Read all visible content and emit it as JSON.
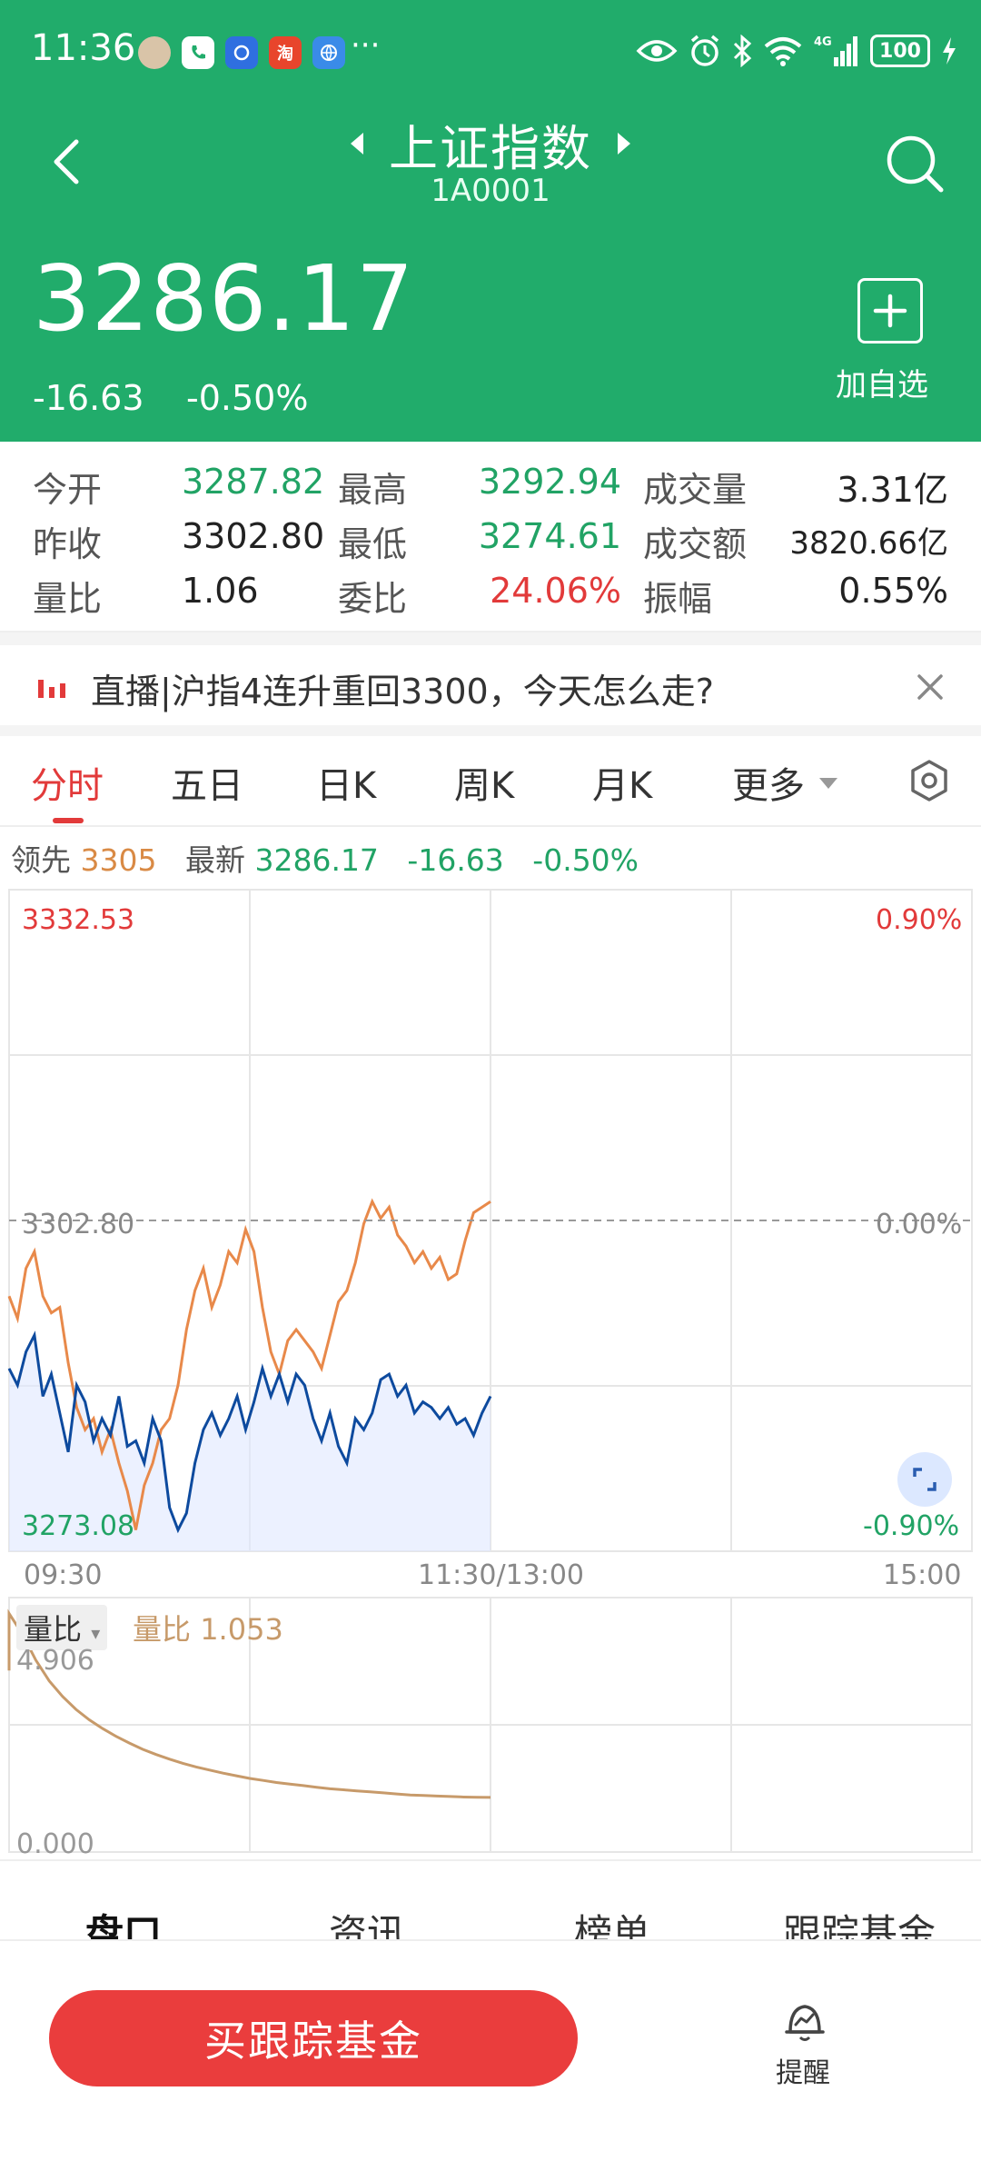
{
  "status_bar": {
    "time": "11:36",
    "app_icons": [
      "avatar-icon",
      "phone-icon",
      "blue-app-icon",
      "taobao-icon",
      "browser-icon"
    ],
    "taobao_char": "淘",
    "dots": "···",
    "network": "4G",
    "battery": "100"
  },
  "nav": {
    "title": "上证指数",
    "code": "1A0001"
  },
  "price": {
    "last": "3286.17",
    "change": "-16.63",
    "change_pct": "-0.50%",
    "add_label": "加自选"
  },
  "quote": {
    "rows": [
      [
        {
          "label": "今开",
          "value": "3287.82"
        },
        {
          "label": "最高",
          "value": "3292.94"
        },
        {
          "label": "成交量",
          "value": "3.31亿"
        }
      ],
      [
        {
          "label": "昨收",
          "value": "3302.80"
        },
        {
          "label": "最低",
          "value": "3274.61"
        },
        {
          "label": "成交额",
          "value": "3820.66亿"
        }
      ],
      [
        {
          "label": "量比",
          "value": "1.06"
        },
        {
          "label": "委比",
          "value": "24.06%"
        },
        {
          "label": "振幅",
          "value": "0.55%"
        }
      ]
    ]
  },
  "news": {
    "text": "直播|沪指4连升重回3300，今天怎么走?"
  },
  "tabs": [
    "分时",
    "五日",
    "日K",
    "周K",
    "月K",
    "更多"
  ],
  "info": {
    "lead_label": "领先",
    "lead_value": "3305",
    "latest_label": "最新",
    "latest_value": "3286.17",
    "change": "-16.63",
    "change_pct": "-0.50%"
  },
  "chart_axis": {
    "y_top": "3332.53",
    "y_mid": "3302.80",
    "y_bottom": "3273.08",
    "pct_top": "0.90%",
    "pct_mid": "0.00%",
    "pct_bottom": "-0.90%",
    "time_start": "09:30",
    "time_mid": "11:30/13:00",
    "time_end": "15:00"
  },
  "volume": {
    "tag": "量比",
    "info_label": "量比",
    "info_value": "1.053",
    "max": "4.906",
    "min": "0.000"
  },
  "bottom_tabs": [
    "盘口",
    "资讯",
    "榜单",
    "跟踪基金"
  ],
  "buy_label": "买跟踪基金",
  "remind_label": "提醒",
  "colors": {
    "header": "#21ac6b",
    "up": "#e23a3a",
    "down": "#21a365",
    "price_line": "#0d4a9e",
    "lead_line": "#e8894a",
    "ratio_line": "#c79a6a"
  },
  "chart_data": {
    "type": "line",
    "ylim": [
      3273.08,
      3332.53
    ],
    "baseline": 3302.8,
    "x_labels": [
      "09:30",
      "11:30/13:00",
      "15:00"
    ],
    "series": [
      {
        "name": "最新",
        "values": [
          3289.5,
          3288.0,
          3291.0,
          3292.5,
          3287.0,
          3289.0,
          3285.5,
          3282.0,
          3288.0,
          3286.5,
          3283.0,
          3285.0,
          3283.5,
          3287.0,
          3282.5,
          3283.0,
          3281.0,
          3285.0,
          3283.0,
          3277.0,
          3275.0,
          3276.5,
          3281.0,
          3284.0,
          3285.5,
          3283.5,
          3285.0,
          3287.0,
          3284.0,
          3286.5,
          3289.5,
          3287.0,
          3289.0,
          3286.5,
          3289.0,
          3288.0,
          3285.0,
          3283.0,
          3285.5,
          3282.5,
          3281.0,
          3285.0,
          3284.0,
          3285.5,
          3288.5,
          3289.0,
          3287.0,
          3288.0,
          3285.5,
          3286.5,
          3286.0,
          3285.0,
          3286.0,
          3284.5,
          3285.0,
          3283.5,
          3285.5,
          3287.0
        ],
        "note": ""
      },
      {
        "name": "领先",
        "values": [
          3296.0,
          3294.0,
          3298.5,
          3300.0,
          3296.0,
          3294.5,
          3295.0,
          3290.0,
          3286.0,
          3284.0,
          3285.0,
          3282.0,
          3284.0,
          3281.0,
          3278.5,
          3275.0,
          3279.0,
          3281.0,
          3284.0,
          3285.0,
          3288.0,
          3293.0,
          3296.5,
          3298.5,
          3295.0,
          3297.0,
          3300.0,
          3299.0,
          3302.0,
          3300.0,
          3295.0,
          3291.0,
          3289.0,
          3292.0,
          3293.0,
          3292.0,
          3291.0,
          3289.5,
          3292.5,
          3295.5,
          3296.5,
          3299.0,
          3302.5,
          3304.5,
          3303.0,
          3304.0,
          3301.5,
          3300.5,
          3299.0,
          3300.0,
          3298.5,
          3299.5,
          3297.5,
          3298.0,
          3301.0,
          3303.5,
          3304.0,
          3304.5
        ]
      }
    ],
    "volume_ratio": {
      "ylim": [
        0,
        4.906
      ],
      "values": [
        4.6,
        4.2,
        3.7,
        3.3,
        3.0,
        2.75,
        2.55,
        2.38,
        2.23,
        2.1,
        1.98,
        1.88,
        1.79,
        1.71,
        1.64,
        1.58,
        1.52,
        1.47,
        1.42,
        1.38,
        1.34,
        1.31,
        1.28,
        1.25,
        1.22,
        1.2,
        1.18,
        1.16,
        1.14,
        1.12,
        1.1,
        1.09,
        1.08,
        1.07,
        1.06,
        1.055,
        1.053
      ]
    }
  }
}
